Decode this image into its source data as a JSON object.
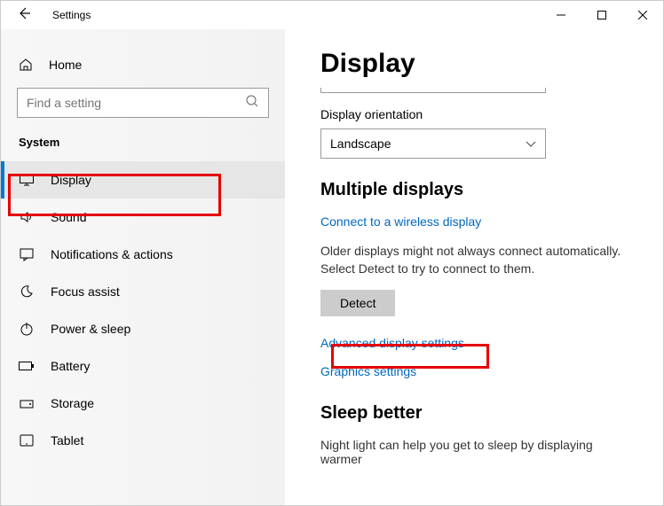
{
  "window": {
    "title": "Settings"
  },
  "home": {
    "label": "Home"
  },
  "search": {
    "placeholder": "Find a setting"
  },
  "category": "System",
  "nav": [
    {
      "label": "Display",
      "icon": "monitor"
    },
    {
      "label": "Sound",
      "icon": "sound"
    },
    {
      "label": "Notifications & actions",
      "icon": "notifications"
    },
    {
      "label": "Focus assist",
      "icon": "moon"
    },
    {
      "label": "Power & sleep",
      "icon": "power"
    },
    {
      "label": "Battery",
      "icon": "battery"
    },
    {
      "label": "Storage",
      "icon": "storage"
    },
    {
      "label": "Tablet",
      "icon": "tablet"
    }
  ],
  "main": {
    "title": "Display",
    "orientation_label": "Display orientation",
    "orientation_value": "Landscape",
    "multiple_displays_header": "Multiple displays",
    "connect_link": "Connect to a wireless display",
    "detect_text": "Older displays might not always connect automatically. Select Detect to try to connect to them.",
    "detect_button": "Detect",
    "advanced_link": "Advanced display settings",
    "graphics_link": "Graphics settings",
    "sleep_header": "Sleep better",
    "sleep_text": "Night light can help you get to sleep by displaying warmer"
  }
}
